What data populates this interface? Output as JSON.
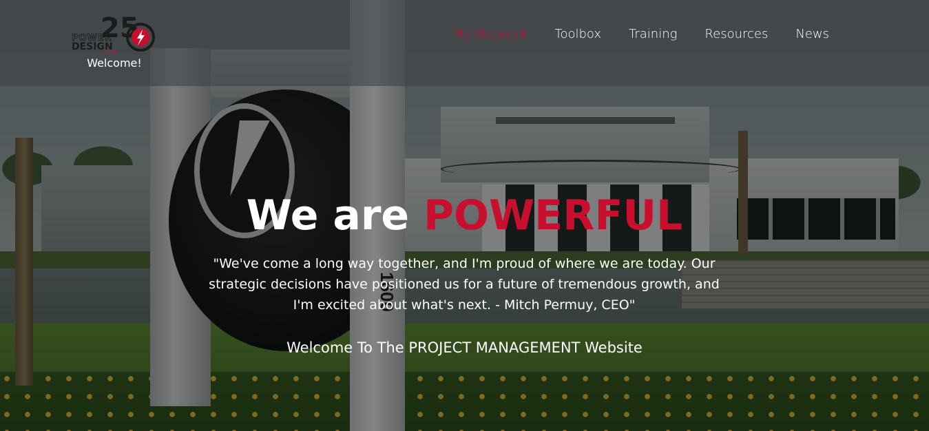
{
  "header": {
    "logo": {
      "text_number": "25",
      "text_top": "POWER",
      "text_bottom": "DESIGN",
      "text_tag": "25 YEARS",
      "brand_color": "#c8102e"
    },
    "welcome": "Welcome!",
    "nav": [
      {
        "label": "My Network",
        "active": true
      },
      {
        "label": "Toolbox",
        "active": false
      },
      {
        "label": "Training",
        "active": false
      },
      {
        "label": "Resources",
        "active": false
      },
      {
        "label": "News",
        "active": false
      }
    ]
  },
  "hero": {
    "title_prefix": "We are ",
    "title_accent": "POWERFUL",
    "quote": "\"We've come a long way together, and I'm proud of where we are today. Our strategic decisions have positioned us for a future of tremendous growth, and I'm excited about what's next. - Mitch Permuy, CEO\"",
    "site_welcome": "Welcome To The PROJECT MANAGEMENT Website"
  },
  "background": {
    "sign_number": "1600"
  },
  "colors": {
    "accent": "#c8102e",
    "text": "#ffffff"
  }
}
